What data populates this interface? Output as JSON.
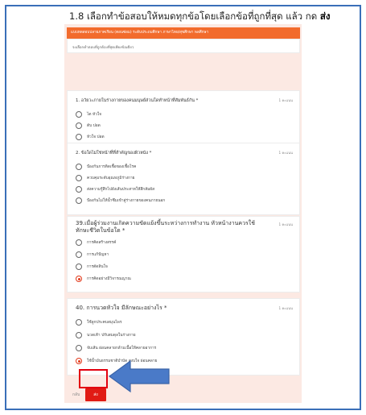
{
  "heading": {
    "text": "1.8 เลือกทำข้อสอบให้หมดทุกข้อโดยเลือกข้อที่ถูกที่สุด แล้ว กด",
    "emphasis": "ส่ง"
  },
  "form": {
    "header_text": "แบบทดสอบปลายภาคเรียน (ตอนซ่อม) ระดับประถมศึกษา ภาษาไทย/สุขศึกษา พลศึกษา",
    "intro_note": "จงเลือกคำตอบที่ถูกต้องที่สุดเพียงข้อเดียว",
    "questions": [
      {
        "title": "1. อวัยวะภายในร่างกายของคนมนุษย์ส่วนใดทำหน้าที่สัมพันธ์กัน *",
        "points": "1 คะแนน",
        "options": [
          "ไต หัวใจ",
          "ตับ ปอด",
          "หัวใจ ปอด",
          "ปอด ไต"
        ],
        "selected": -1
      },
      {
        "title": "2. ข้อใดไม่ใช่หน้าที่ที่สำคัญของผิวหนัง *",
        "points": "1 คะแนน",
        "options": [
          "ป้องกันการติดเชื้อของเชื้อโรค",
          "ควบคุมระดับอุณหภูมิร่างกาย",
          "ส่งความรู้สึกไปยังเส้นประสาทให้สึกสัมผัส",
          "ป้องกันไม่ให้น้ำซึมเข้าสู่ร่างกายของคนภายนอก"
        ],
        "selected": -1
      },
      {
        "title": "39.เมื่อผู้ร่วมงานเกิดความขัดแย้งขึ้นระหว่างการทำงาน หัวหน้างานควรใช้ทักษะชีวิตในข้อใด *",
        "points": "1 คะแนน",
        "options": [
          "การคิดสร้างสรรค์",
          "การแก้ปัญหา",
          "การตัดสินใจ",
          "การคิดอย่างมีวิจารณญาณ"
        ],
        "selected": 3
      },
      {
        "title": "40. การนวดหัวใจ มีลักษณะอย่างไร *",
        "points": "1 คะแนน",
        "options": [
          "ใช้ลูกประคบสมุนไพร",
          "นวดเท้า ปรับสมดุลในร่างกาย",
          "จับเส้น ผ่อนคลายกล้ามเนื้อให้คลายอาการ",
          "ใช้น้ำมันธรรมชาติบำบัด สงบใจ ผ่อนคลาย"
        ],
        "selected": 3
      }
    ],
    "nav": {
      "back": "กลับ",
      "submit": "ส่ง"
    }
  },
  "colors": {
    "form_accent": "#f26b2c",
    "submit": "#e11b14",
    "highlight": "#e3000f",
    "arrow": "#4a7ac8",
    "frame": "#3a6fb8"
  }
}
